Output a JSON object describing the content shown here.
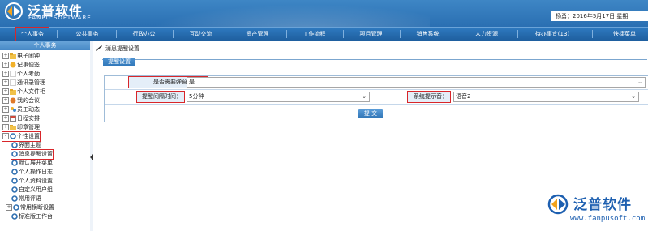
{
  "header": {
    "brand_cn": "泛普软件",
    "brand_en": "FANPU SOFTWARE",
    "user_info": "杨勇：2016年5月17日  星期"
  },
  "nav": [
    "个人事务",
    "公共事务",
    "行政办公",
    "互动交流",
    "资产管理",
    "工作流程",
    "项目管理",
    "销售系统",
    "人力资源",
    "待办事宜(13)",
    "快捷菜单"
  ],
  "sidebar": {
    "title": "个人事务",
    "items": [
      {
        "label": "电子闹钟",
        "icon": "folder-icon",
        "expand": "+"
      },
      {
        "label": "记事便签",
        "icon": "note-icon",
        "expand": "+"
      },
      {
        "label": "个人考勤",
        "icon": "doc-icon",
        "expand": "+"
      },
      {
        "label": "通讯录管理",
        "icon": "doc-icon",
        "expand": "+"
      },
      {
        "label": "个人文件柜",
        "icon": "folder-icon",
        "expand": "+"
      },
      {
        "label": "我的会议",
        "icon": "meeting-icon",
        "expand": "+"
      },
      {
        "label": "员工动态",
        "icon": "people-icon",
        "expand": "+"
      },
      {
        "label": "日程安排",
        "icon": "calendar-icon",
        "expand": "+"
      },
      {
        "label": "印章管理",
        "icon": "folder-icon",
        "expand": "+"
      },
      {
        "label": "个性设置",
        "icon": "settings-icon",
        "expand": "-"
      },
      {
        "label": "界面主题",
        "icon": "gear-icon"
      },
      {
        "label": "消息提醒设置",
        "icon": "gear-icon"
      },
      {
        "label": "默认展开菜单",
        "icon": "gear-icon"
      },
      {
        "label": "个人操作日志",
        "icon": "gear-icon"
      },
      {
        "label": "个人资料设置",
        "icon": "gear-icon"
      },
      {
        "label": "自定义用户组",
        "icon": "gear-icon"
      },
      {
        "label": "常用评语",
        "icon": "gear-icon"
      },
      {
        "label": "常用横断设置",
        "icon": "gear-icon",
        "expand": "+"
      },
      {
        "label": "标准版工作台",
        "icon": "gear-icon"
      }
    ]
  },
  "main": {
    "breadcrumb": "消息提醒设置",
    "tab": "提醒设置",
    "form": {
      "popup_label": "是否需要弹窗提醒：",
      "popup_value": "是",
      "interval_label": "提醒间隔时间：",
      "interval_value": "5分钟",
      "sound_label": "系统提示音：",
      "sound_value": "语音2",
      "submit": "提 交"
    }
  },
  "watermark": {
    "cn": "泛普软件",
    "url": "www.fanpusoft.com"
  }
}
